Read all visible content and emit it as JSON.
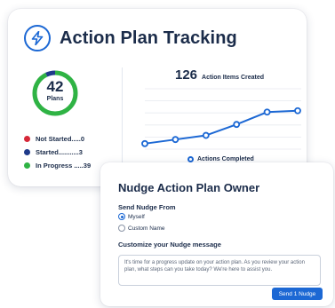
{
  "tracking": {
    "title": "Action Plan Tracking",
    "icon": "lightning-bolt-icon",
    "donut": {
      "total": "42",
      "label": "Plans",
      "segments": [
        {
          "name": "Not Started",
          "value": 0,
          "color": "#d62839"
        },
        {
          "name": "Started",
          "value": 3,
          "color": "#1f3a8a"
        },
        {
          "name": "In Progress",
          "value": 39,
          "color": "#2fb344"
        }
      ]
    },
    "statuses": [
      {
        "label": "Not Started.....0",
        "color": "#d62839"
      },
      {
        "label": "Started...........3",
        "color": "#1f3a8a"
      },
      {
        "label": "In Progress .....39",
        "color": "#2fb344"
      }
    ],
    "created_count": "126",
    "created_label": "Action Items Created"
  },
  "chart_data": {
    "type": "line",
    "title": "",
    "xlabel": "",
    "ylabel": "",
    "grid": true,
    "legend_position": "bottom",
    "series": [
      {
        "name": "Actions Completed",
        "color": "#1c68d4",
        "values": [
          0,
          3,
          6,
          14,
          23,
          24
        ]
      }
    ],
    "ylim": [
      -4,
      40
    ]
  },
  "nudge": {
    "title": "Nudge Action Plan Owner",
    "send_from_label": "Send Nudge From",
    "options": [
      {
        "label": "Myself",
        "checked": true
      },
      {
        "label": "Custom Name",
        "checked": false
      }
    ],
    "customize_label": "Customize your Nudge message",
    "message": "It's time for a progress update on your action plan. As you review your action plan, what steps can you take today? We're here to assist you.",
    "send_label": "Send 1 Nudge"
  },
  "colors": {
    "accent": "#1c68d4",
    "text": "#1b2c4a",
    "not_started": "#d62839",
    "started": "#1f3a8a",
    "in_progress": "#2fb344"
  }
}
